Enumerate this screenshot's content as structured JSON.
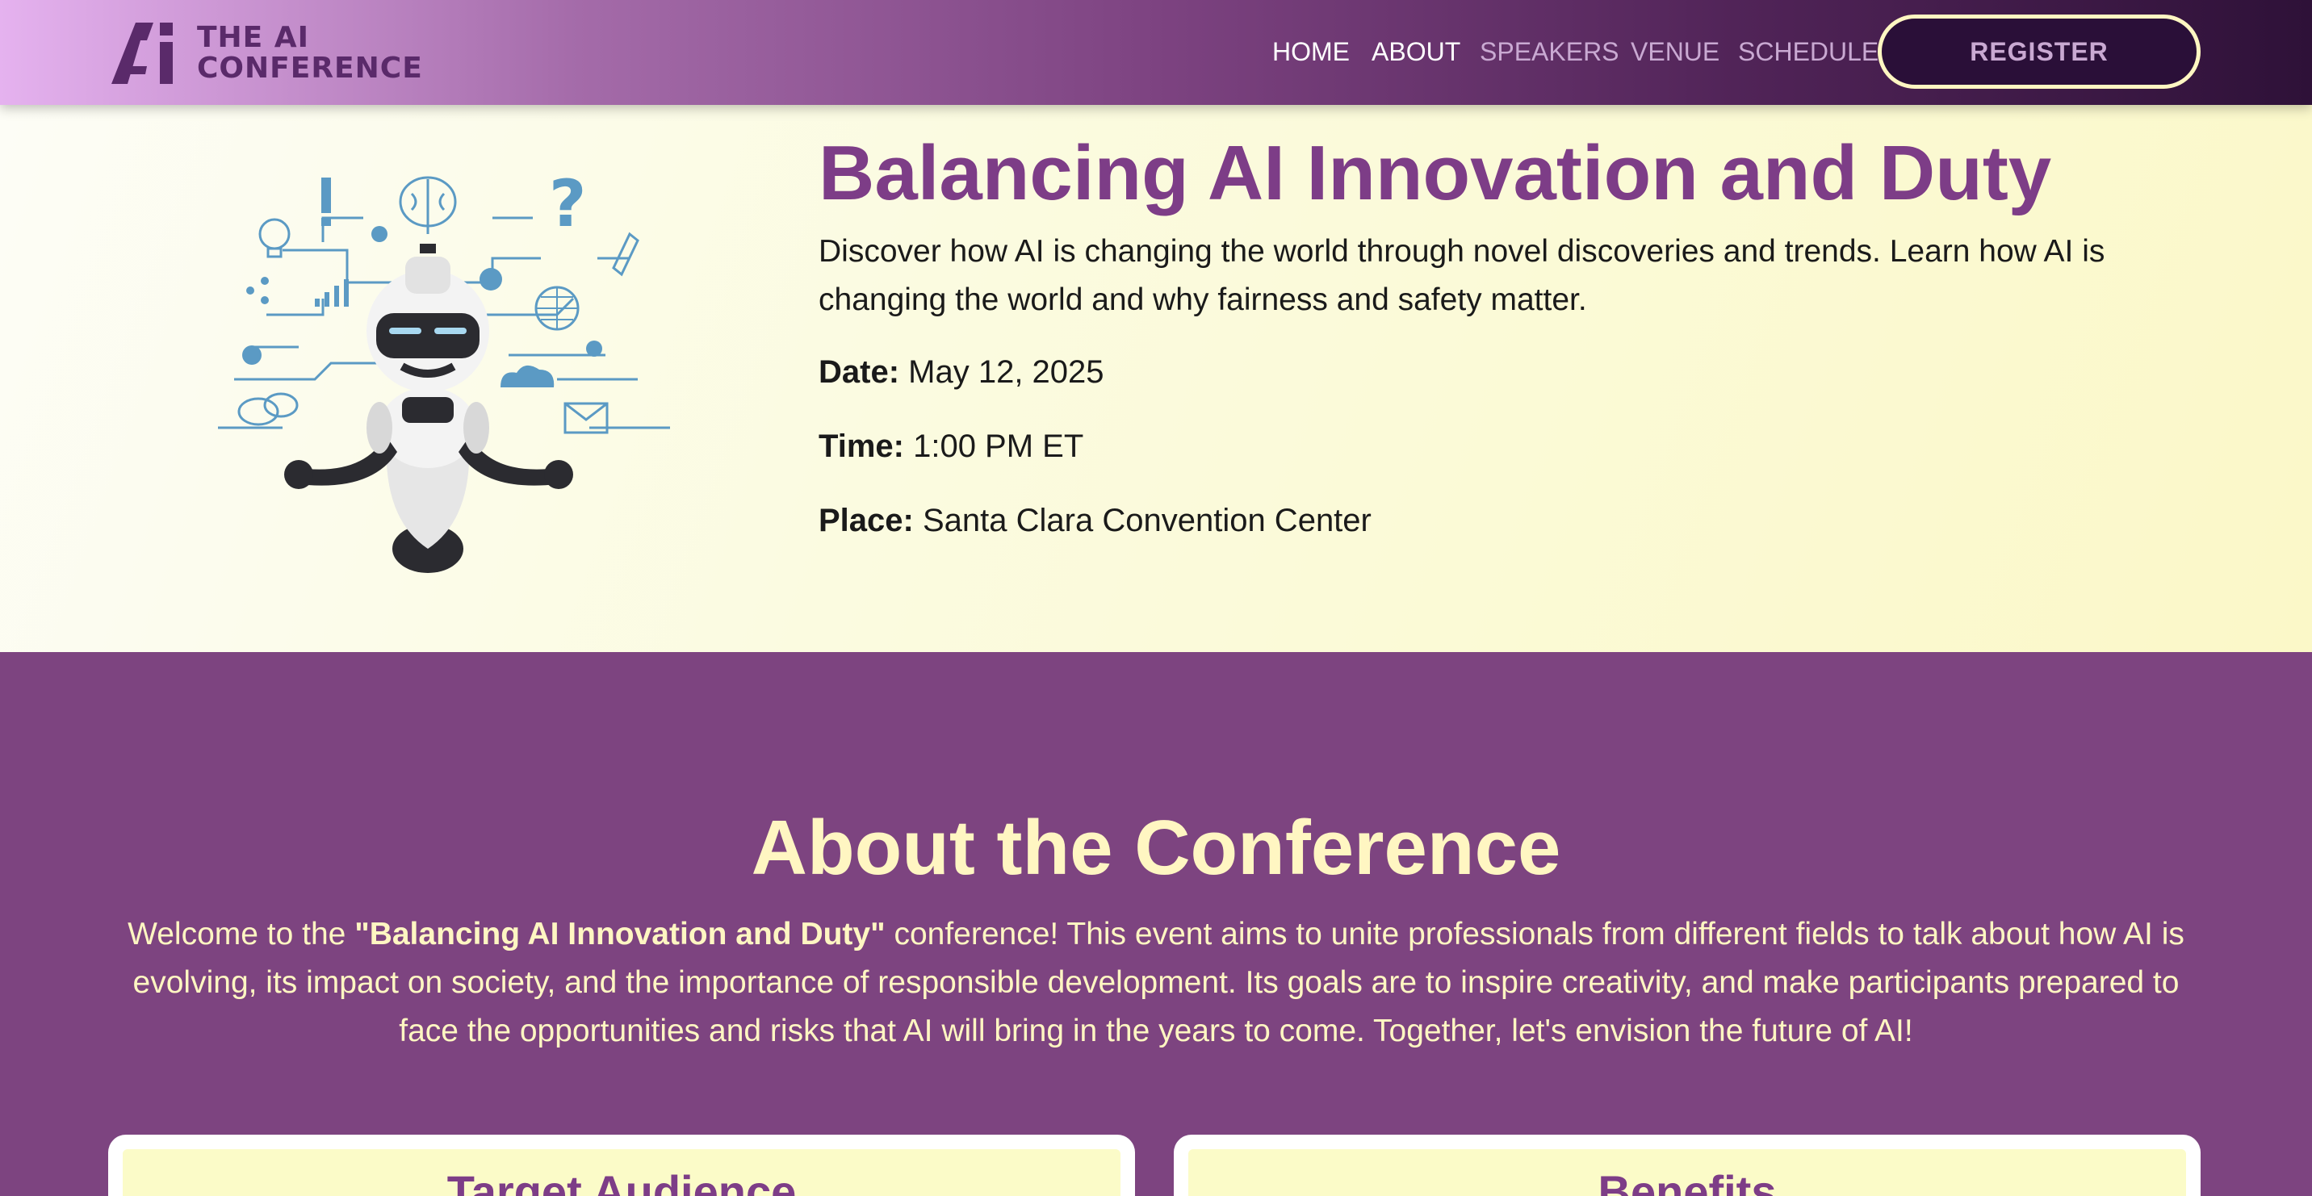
{
  "header": {
    "logo_line1": "THE AI",
    "logo_line2": "CONFERENCE",
    "nav": [
      {
        "label": "HOME"
      },
      {
        "label": "ABOUT"
      },
      {
        "label": "SPEAKERS"
      },
      {
        "label": "VENUE"
      },
      {
        "label": "SCHEDULE"
      }
    ],
    "register_label": "REGISTER"
  },
  "hero": {
    "title": "Balancing AI Innovation and Duty",
    "description": "Discover how AI is changing the world through novel discoveries and trends. Learn how AI is changing the world and why fairness and safety matter.",
    "date_label": "Date:",
    "date_value": "May 12, 2025",
    "time_label": "Time:",
    "time_value": "1:00 PM ET",
    "place_label": "Place:",
    "place_value": "Santa Clara Convention Center"
  },
  "about": {
    "title": "About the Conference",
    "text_before": "Welcome to the ",
    "text_bold": "\"Balancing AI Innovation and Duty\"",
    "text_after": " conference! This event aims to unite professionals from different fields to talk about how AI is evolving, its impact on society, and the importance of responsible development. Its goals are to inspire creativity, and make participants prepared to face the opportunities and risks that AI will bring in the years to come. Together, let's envision the future of AI!",
    "cards": [
      {
        "title": "Target Audience"
      },
      {
        "title": "Benefits"
      }
    ]
  },
  "colors": {
    "primary_purple": "#7d4480",
    "title_purple": "#7d3d87",
    "cream": "#fff6c2",
    "hero_bg": "#fbfbe0"
  }
}
